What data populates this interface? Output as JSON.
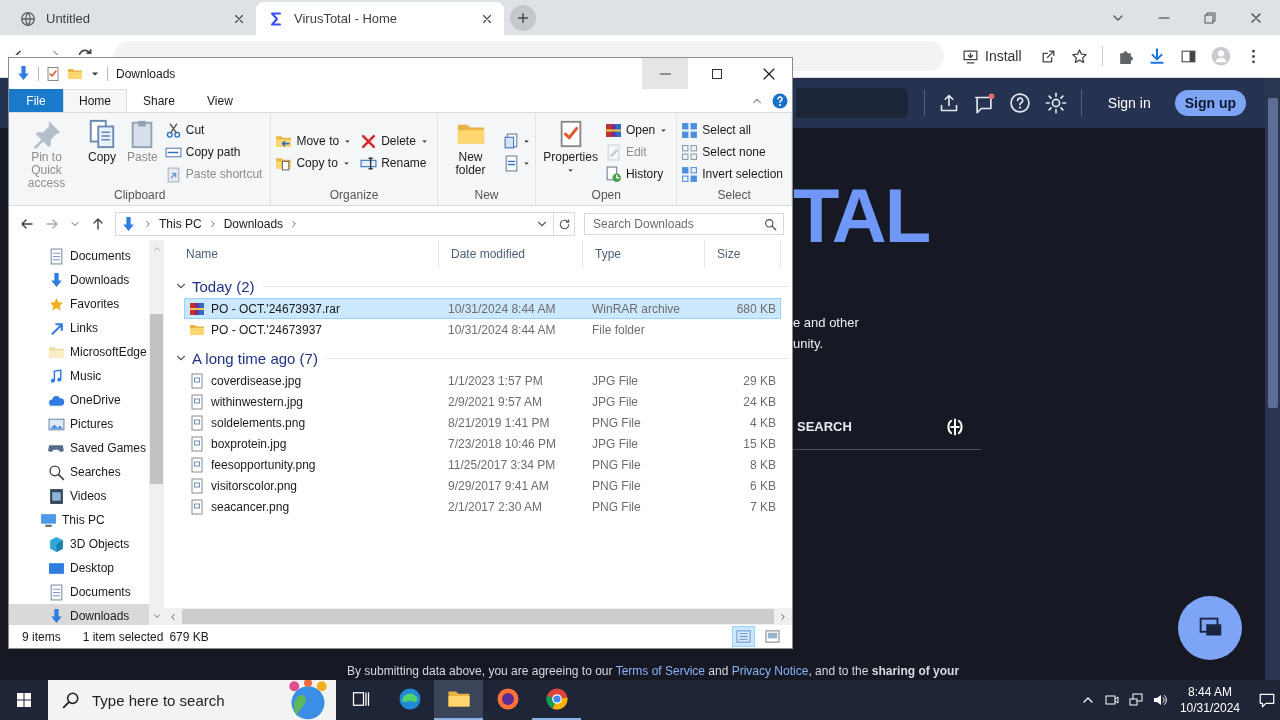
{
  "browser": {
    "tabs": [
      {
        "title": "Untitled",
        "selected": false
      },
      {
        "title": "VirusTotal - Home",
        "selected": true
      }
    ],
    "install": "Install"
  },
  "page": {
    "header": {
      "sign_in": "Sign in",
      "sign_up": "Sign up"
    },
    "logo_fragment": "TAL",
    "intro_lines": [
      "e and other",
      "unity."
    ],
    "search_tab": "SEARCH",
    "footer": [
      {
        "kind": "text",
        "text": "By submitting data above, you are agreeing to our "
      },
      {
        "kind": "link",
        "text": "Terms of Service"
      },
      {
        "kind": "text",
        "text": " and "
      },
      {
        "kind": "link",
        "text": "Privacy Notice"
      },
      {
        "kind": "text",
        "text": ", and to the **sharing of your**"
      }
    ]
  },
  "explorer": {
    "title": "Downloads",
    "ribbon_tabs": [
      {
        "label": "File",
        "kind": "file",
        "selected": false
      },
      {
        "label": "Home",
        "kind": "tab",
        "selected": true
      },
      {
        "label": "Share",
        "kind": "tab",
        "selected": false
      },
      {
        "label": "View",
        "kind": "tab",
        "selected": false
      }
    ],
    "ribbon_groups": [
      {
        "name": "Clipboard",
        "columns": [
          [
            {
              "label": "Pin to Quick access",
              "kind": "large",
              "dropdown": false,
              "disabled": true
            }
          ],
          [
            {
              "label": "Copy",
              "kind": "large",
              "dropdown": false,
              "disabled": false
            }
          ],
          [
            {
              "label": "Paste",
              "kind": "large",
              "dropdown": false,
              "disabled": true
            }
          ],
          [
            {
              "label": "Cut",
              "kind": "small",
              "dropdown": false,
              "disabled": false
            },
            {
              "label": "Copy path",
              "kind": "small",
              "dropdown": false,
              "disabled": false
            },
            {
              "label": "Paste shortcut",
              "kind": "small",
              "dropdown": false,
              "disabled": true
            }
          ]
        ]
      },
      {
        "name": "Organize",
        "columns": [
          [
            {
              "label": "Move to",
              "kind": "small",
              "dropdown": true,
              "disabled": false
            },
            {
              "label": "Copy to",
              "kind": "small",
              "dropdown": true,
              "disabled": false
            }
          ],
          [
            {
              "label": "Delete",
              "kind": "small",
              "dropdown": true,
              "disabled": false
            },
            {
              "label": "Rename",
              "kind": "small",
              "dropdown": false,
              "disabled": false
            }
          ]
        ]
      },
      {
        "name": "New",
        "columns": [
          [
            {
              "label": "New folder",
              "kind": "large",
              "dropdown": false,
              "disabled": false
            }
          ],
          [
            {
              "kind": "icon",
              "dropdown": true,
              "disabled": false
            },
            {
              "kind": "icon",
              "dropdown": true,
              "disabled": false
            }
          ]
        ]
      },
      {
        "name": "Open",
        "columns": [
          [
            {
              "label": "Properties",
              "kind": "large",
              "dropdown": true,
              "disabled": false
            }
          ],
          [
            {
              "label": "Open",
              "kind": "small",
              "dropdown": true,
              "disabled": false
            },
            {
              "label": "Edit",
              "kind": "small",
              "dropdown": false,
              "disabled": true
            },
            {
              "label": "History",
              "kind": "small",
              "dropdown": false,
              "disabled": false
            }
          ]
        ]
      },
      {
        "name": "Select",
        "columns": [
          [
            {
              "label": "Select all",
              "kind": "small",
              "dropdown": false,
              "disabled": false
            },
            {
              "label": "Select none",
              "kind": "small",
              "dropdown": false,
              "disabled": false
            },
            {
              "label": "Invert selection",
              "kind": "small",
              "dropdown": false,
              "disabled": false
            }
          ]
        ]
      }
    ],
    "address": {
      "path": [
        "This PC",
        "Downloads"
      ],
      "placeholder": "Search Downloads"
    },
    "nav": [
      {
        "label": "Documents",
        "selected": false
      },
      {
        "label": "Downloads",
        "selected": false
      },
      {
        "label": "Favorites",
        "selected": false
      },
      {
        "label": "Links",
        "selected": false
      },
      {
        "label": "MicrosoftEdge",
        "selected": false
      },
      {
        "label": "Music",
        "selected": false
      },
      {
        "label": "OneDrive",
        "selected": false
      },
      {
        "label": "Pictures",
        "selected": false
      },
      {
        "label": "Saved Games",
        "selected": false
      },
      {
        "label": "Searches",
        "selected": false
      },
      {
        "label": "Videos",
        "selected": false
      },
      {
        "label": "This PC",
        "selected": false,
        "children": [
          {
            "label": "3D Objects",
            "selected": false
          },
          {
            "label": "Desktop",
            "selected": false
          },
          {
            "label": "Documents",
            "selected": false
          },
          {
            "label": "Downloads",
            "selected": true
          }
        ]
      }
    ],
    "columns": [
      "Name",
      "Date modified",
      "Type",
      "Size"
    ],
    "groups": [
      {
        "title": "Today (2)",
        "expanded": true,
        "rows": [
          {
            "name": "PO - OCT.'24673937.rar",
            "date": "10/31/2024 8:44 AM",
            "type": "WinRAR archive",
            "size": "680 KB",
            "kind": "archive",
            "selected": true
          },
          {
            "name": "PO - OCT.'24673937",
            "date": "10/31/2024 8:44 AM",
            "type": "File folder",
            "size": "",
            "kind": "folder",
            "selected": false
          }
        ]
      },
      {
        "title": "A long time ago (7)",
        "expanded": true,
        "rows": [
          {
            "name": "coverdisease.jpg",
            "date": "1/1/2023 1:57 PM",
            "type": "JPG File",
            "size": "29 KB",
            "kind": "file",
            "selected": false
          },
          {
            "name": "withinwestern.jpg",
            "date": "2/9/2021 9:57 AM",
            "type": "JPG File",
            "size": "24 KB",
            "kind": "file",
            "selected": false
          },
          {
            "name": "soldelements.png",
            "date": "8/21/2019 1:41 PM",
            "type": "PNG File",
            "size": "4 KB",
            "kind": "file",
            "selected": false
          },
          {
            "name": "boxprotein.jpg",
            "date": "7/23/2018 10:46 PM",
            "type": "JPG File",
            "size": "15 KB",
            "kind": "file",
            "selected": false
          },
          {
            "name": "feesopportunity.png",
            "date": "11/25/2017 3:34 PM",
            "type": "PNG File",
            "size": "8 KB",
            "kind": "file",
            "selected": false
          },
          {
            "name": "visitorscolor.png",
            "date": "9/29/2017 9:41 AM",
            "type": "PNG File",
            "size": "6 KB",
            "kind": "file",
            "selected": false
          },
          {
            "name": "seacancer.png",
            "date": "2/1/2017 2:30 AM",
            "type": "PNG File",
            "size": "7 KB",
            "kind": "file",
            "selected": false
          }
        ]
      }
    ],
    "status": {
      "count": "9 items",
      "selection": "1 item selected",
      "selection_size": "679 KB"
    },
    "view_modes": [
      {
        "selected": true
      },
      {
        "selected": false
      }
    ]
  },
  "taskbar": {
    "placeholder": "Type here to search",
    "apps": [
      {
        "active": false,
        "running": false
      },
      {
        "active": true,
        "running": true
      },
      {
        "active": false,
        "running": false
      },
      {
        "active": false,
        "running": true
      }
    ],
    "time": "8:44 AM",
    "date": "10/31/2024"
  }
}
